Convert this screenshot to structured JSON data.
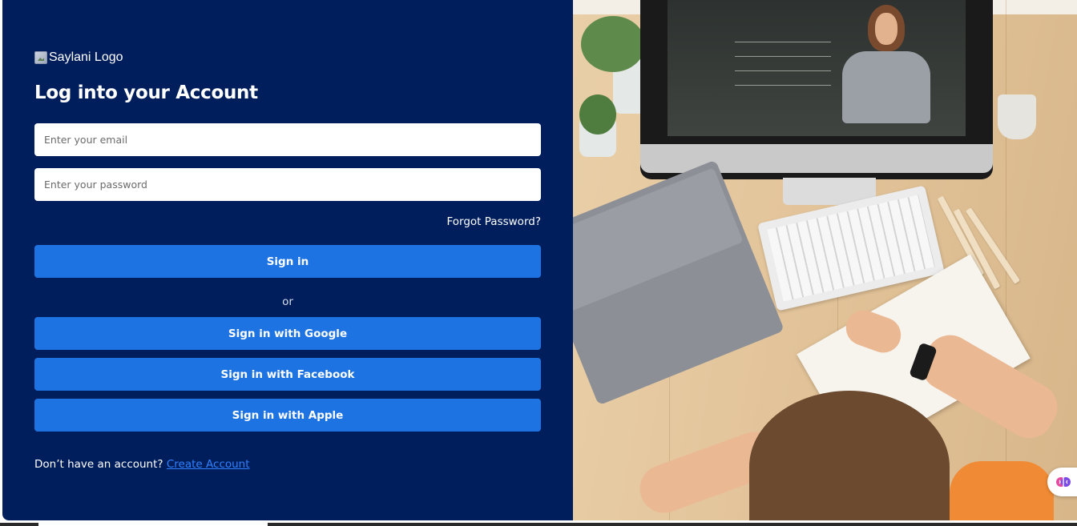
{
  "logo": {
    "alt_text": "Saylani Logo"
  },
  "heading": "Log into your Account",
  "form": {
    "email_placeholder": "Enter your email",
    "password_placeholder": "Enter your password",
    "forgot_password": "Forgot Password?",
    "sign_in": "Sign in",
    "divider": "or",
    "google": "Sign in with Google",
    "facebook": "Sign in with Facebook",
    "apple": "Sign in with Apple"
  },
  "signup": {
    "prompt": "Don’t have an account?",
    "link": "Create Account"
  },
  "colors": {
    "panel": "#001e5c",
    "button": "#1e73e3",
    "link": "#2f82ff"
  },
  "icons": [
    "broken-image-icon",
    "brain-icon"
  ]
}
